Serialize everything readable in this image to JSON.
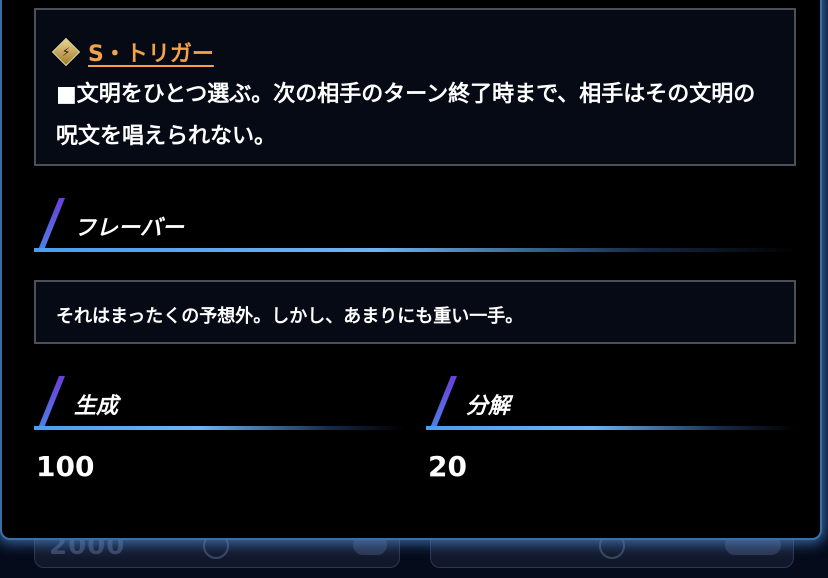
{
  "ability": {
    "trigger_name": "S・トリガー",
    "trigger_icon": "lightning-diamond-icon",
    "text": "■文明をひとつ選ぶ。次の相手のターン終了時まで、相手はその文明の呪文を唱えられない。"
  },
  "flavor": {
    "heading": "フレーバー",
    "text": "それはまったくの予想外。しかし、あまりにも重い一手。"
  },
  "generate": {
    "heading": "生成",
    "value": "100"
  },
  "disassemble": {
    "heading": "分解",
    "value": "20"
  },
  "colors": {
    "panel_glow": "#488cdc",
    "trigger_link": "#f2a24a",
    "heading_accent": "#4a9df0"
  }
}
